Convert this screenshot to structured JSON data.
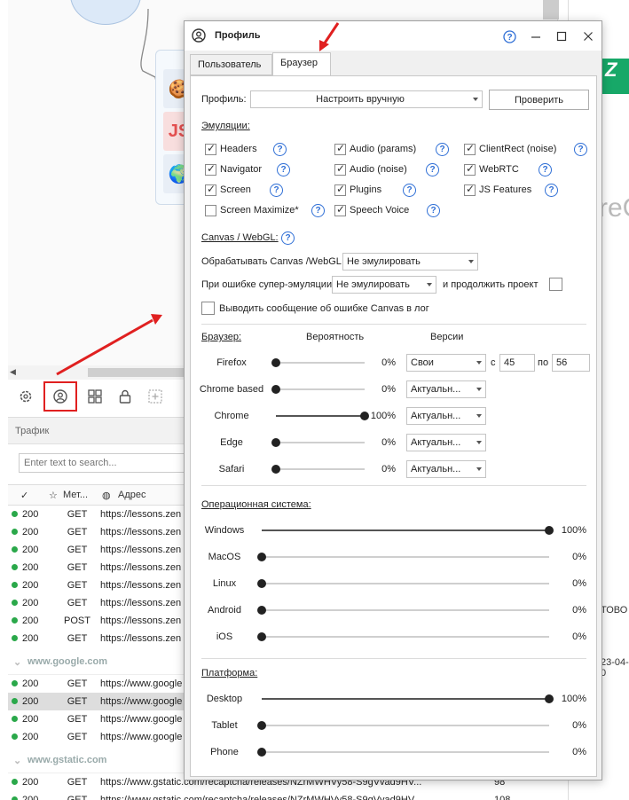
{
  "background": {
    "toolbar_icons": [
      "gear-icon",
      "profile-icon",
      "grid-icon",
      "lock-icon",
      "add-frame-icon"
    ],
    "traffic": {
      "title": "Трафик",
      "search_placeholder": "Enter text to search...",
      "columns": {
        "method": "Мет...",
        "address": "Адрес"
      },
      "groups": [
        {
          "name": "",
          "rows": [
            {
              "code": "200",
              "method": "GET",
              "url": "https://lessons.zen"
            },
            {
              "code": "200",
              "method": "GET",
              "url": "https://lessons.zen"
            },
            {
              "code": "200",
              "method": "GET",
              "url": "https://lessons.zen"
            },
            {
              "code": "200",
              "method": "GET",
              "url": "https://lessons.zen"
            },
            {
              "code": "200",
              "method": "GET",
              "url": "https://lessons.zen"
            },
            {
              "code": "200",
              "method": "GET",
              "url": "https://lessons.zen"
            },
            {
              "code": "200",
              "method": "POST",
              "url": "https://lessons.zen"
            },
            {
              "code": "200",
              "method": "GET",
              "url": "https://lessons.zen"
            }
          ]
        },
        {
          "name": "www.google.com",
          "rows": [
            {
              "code": "200",
              "method": "GET",
              "url": "https://www.google"
            },
            {
              "code": "200",
              "method": "GET",
              "url": "https://www.google",
              "selected": true
            },
            {
              "code": "200",
              "method": "GET",
              "url": "https://www.google"
            },
            {
              "code": "200",
              "method": "GET",
              "url": "https://www.google"
            }
          ]
        },
        {
          "name": "www.gstatic.com",
          "rows": [
            {
              "code": "200",
              "method": "GET",
              "url": "https://www.gstatic.com/recaptcha/releases/NZrMWHVy58-S9gVvad9HV...",
              "size": "98"
            },
            {
              "code": "200",
              "method": "GET",
              "url": "https://www.gstatic.com/recaptcha/releases/NZrMWHVy58-S9gVvad9HV...",
              "size": "108"
            }
          ]
        }
      ]
    },
    "right_pane": {
      "big_text": "reC",
      "text1": "ТОВО",
      "text2": "23-04-0"
    }
  },
  "dialog": {
    "title": "Профиль",
    "tabs": [
      "Пользователь",
      "Браузер"
    ],
    "active_tab": 1,
    "profile": {
      "label": "Профиль:",
      "value": "Настроить вручную",
      "check_button": "Проверить"
    },
    "emulations": {
      "title": "Эмуляции:",
      "items": [
        {
          "label": "Headers",
          "checked": true
        },
        {
          "label": "Audio (params)",
          "checked": true
        },
        {
          "label": "ClientRect (noise)",
          "checked": true
        },
        {
          "label": "Navigator",
          "checked": true
        },
        {
          "label": "Audio (noise)",
          "checked": true
        },
        {
          "label": "WebRTC",
          "checked": true
        },
        {
          "label": "Screen",
          "checked": true
        },
        {
          "label": "Plugins",
          "checked": true
        },
        {
          "label": "JS Features",
          "checked": true
        },
        {
          "label": "Screen Maximize*",
          "checked": false
        },
        {
          "label": "Speech Voice",
          "checked": true
        }
      ]
    },
    "canvas": {
      "title": "Canvas / WebGL:",
      "process_label": "Обрабатывать Canvas /WebGL",
      "process_value": "Не эмулировать",
      "error_label": "При ошибке супер-эмуляции",
      "error_value": "Не эмулировать",
      "continue_label": "и продолжить проект",
      "continue_checked": false,
      "log_label": "Выводить сообщение об ошибке Canvas в лог",
      "log_checked": false
    },
    "browser": {
      "title": "Браузер:",
      "col_probability": "Вероятность",
      "col_versions": "Версии",
      "from_label": "с",
      "to_label": "по",
      "rows": [
        {
          "name": "Firefox",
          "value": 0,
          "pct": "0%",
          "version": "Свои",
          "from": "45",
          "to": "56"
        },
        {
          "name": "Chrome based",
          "value": 0,
          "pct": "0%",
          "version": "Актуальн..."
        },
        {
          "name": "Chrome",
          "value": 100,
          "pct": "100%",
          "version": "Актуальн..."
        },
        {
          "name": "Edge",
          "value": 0,
          "pct": "0%",
          "version": "Актуальн..."
        },
        {
          "name": "Safari",
          "value": 0,
          "pct": "0%",
          "version": "Актуальн..."
        }
      ]
    },
    "os": {
      "title": "Операционная система:",
      "rows": [
        {
          "name": "Windows",
          "value": 100,
          "pct": "100%"
        },
        {
          "name": "MacOS",
          "value": 0,
          "pct": "0%"
        },
        {
          "name": "Linux",
          "value": 0,
          "pct": "0%"
        },
        {
          "name": "Android",
          "value": 0,
          "pct": "0%"
        },
        {
          "name": "iOS",
          "value": 0,
          "pct": "0%"
        }
      ]
    },
    "platform": {
      "title": "Платформа:",
      "rows": [
        {
          "name": "Desktop",
          "value": 100,
          "pct": "100%"
        },
        {
          "name": "Tablet",
          "value": 0,
          "pct": "0%"
        },
        {
          "name": "Phone",
          "value": 0,
          "pct": "0%"
        }
      ]
    }
  },
  "colors": {
    "accent": "#2f6fd6",
    "annotation": "#e02020",
    "status_ok": "#2aa84a"
  }
}
